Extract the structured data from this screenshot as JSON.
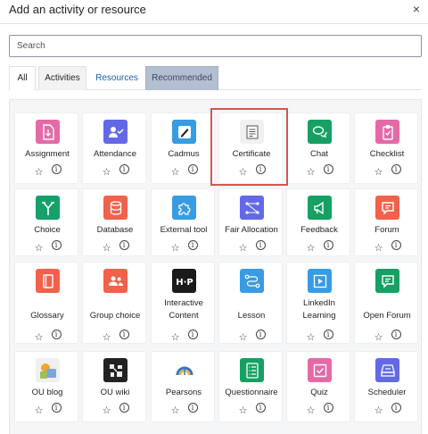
{
  "dialog": {
    "title": "Add an activity or resource",
    "close_symbol": "×"
  },
  "search": {
    "placeholder": "Search",
    "value": ""
  },
  "tabs": [
    {
      "label": "All",
      "selected": false
    },
    {
      "label": "Activities",
      "selected": false
    },
    {
      "label": "Resources",
      "selected": false
    },
    {
      "label": "Recommended",
      "selected": true
    }
  ],
  "star_symbol": "☆",
  "info_symbol": "i",
  "modules": [
    {
      "label": "Assignment",
      "icon": "assignment-icon",
      "color": "#e46aa7"
    },
    {
      "label": "Attendance",
      "icon": "attendance-icon",
      "color": "#6369e6"
    },
    {
      "label": "Cadmus",
      "icon": "cadmus-icon",
      "color": "#399be2"
    },
    {
      "label": "Certificate",
      "icon": "certificate-icon",
      "color": "#f0f0f0"
    },
    {
      "label": "Chat",
      "icon": "chat-icon",
      "color": "#16a064"
    },
    {
      "label": "Checklist",
      "icon": "checklist-icon",
      "color": "#e46aa7"
    },
    {
      "label": "Choice",
      "icon": "choice-icon",
      "color": "#16a06a"
    },
    {
      "label": "Database",
      "icon": "database-icon",
      "color": "#f2614b"
    },
    {
      "label": "External tool",
      "icon": "external-tool-icon",
      "color": "#399be2"
    },
    {
      "label": "Fair Allocation",
      "icon": "fair-allocation-icon",
      "color": "#6369e6"
    },
    {
      "label": "Feedback",
      "icon": "feedback-icon",
      "color": "#16a064"
    },
    {
      "label": "Forum",
      "icon": "forum-icon",
      "color": "#f2614b"
    },
    {
      "label": "Glossary",
      "icon": "glossary-icon",
      "color": "#f2614b"
    },
    {
      "label": "Group choice",
      "icon": "group-choice-icon",
      "color": "#f2614b"
    },
    {
      "label": "Interactive Content",
      "icon": "h5p-icon",
      "color": "#1a1a1a"
    },
    {
      "label": "Lesson",
      "icon": "lesson-icon",
      "color": "#399be2"
    },
    {
      "label": "LinkedIn Learning",
      "icon": "linkedin-learning-icon",
      "color": "#399be2"
    },
    {
      "label": "Open Forum",
      "icon": "open-forum-icon",
      "color": "#16a064"
    },
    {
      "label": "OU blog",
      "icon": "ou-blog-icon",
      "color": "#f0f0f0"
    },
    {
      "label": "OU wiki",
      "icon": "ou-wiki-icon",
      "color": "#222222"
    },
    {
      "label": "Pearsons",
      "icon": "pearsons-icon",
      "color": "#ffffff"
    },
    {
      "label": "Questionnaire",
      "icon": "questionnaire-icon",
      "color": "#16a064"
    },
    {
      "label": "Quiz",
      "icon": "quiz-icon",
      "color": "#e46aa7"
    },
    {
      "label": "Scheduler",
      "icon": "scheduler-icon",
      "color": "#6369e6"
    }
  ]
}
